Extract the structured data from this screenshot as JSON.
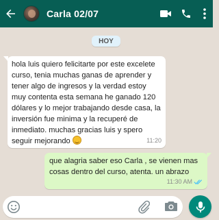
{
  "header": {
    "contact_name": "Carla 02/07",
    "icons": [
      "back-arrow-icon",
      "avatar",
      "video-call-icon",
      "phone-icon",
      "more-vert-icon"
    ]
  },
  "chat": {
    "day_label": "HOY",
    "messages": [
      {
        "direction": "incoming",
        "text": "hola luis quiero felicitarte por este excelete curso, tenia muchas ganas de aprender y tener algo de ingresos y la verdad estoy muy contenta esta semana he ganado 120 dólares y lo mejor trabajando desde casa, la inversión fue minima y la recuperé de inmediato. muchas gracias luis y spero seguir mejorando",
        "emoji": "smiling-face",
        "time": "11:20"
      },
      {
        "direction": "outgoing",
        "text": "que alagria saber eso Carla , se vienen mas cosas dentro del curso, atenta. un abrazo",
        "time": "11:30 AM",
        "status": "read-double-check"
      }
    ]
  },
  "composer": {
    "icons": [
      "emoji-icon",
      "attach-icon",
      "camera-icon",
      "mic-icon"
    ]
  },
  "colors": {
    "header_bg": "#075e54",
    "chat_bg": "#e5ddd5",
    "outgoing_bubble": "#dcf8c6",
    "incoming_bubble": "#ffffff",
    "mic_button": "#00897b",
    "read_ticks": "#4fc3f7"
  }
}
